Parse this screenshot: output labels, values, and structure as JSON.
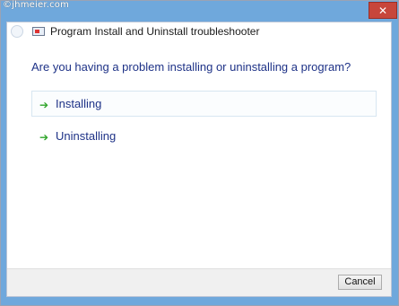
{
  "watermark": "©jhmeier.com",
  "window": {
    "title": "Program Install and Uninstall troubleshooter",
    "close_glyph": "✕"
  },
  "main": {
    "question": "Are you having a problem installing or uninstalling a program?",
    "options": [
      {
        "label": "Installing",
        "icon": "green-arrow-icon"
      },
      {
        "label": "Uninstalling",
        "icon": "green-arrow-icon"
      }
    ],
    "arrow_glyph": "➔"
  },
  "footer": {
    "cancel_label": "Cancel"
  },
  "colors": {
    "accent": "#1e3287",
    "arrow": "#2fa52a",
    "frame": "#6fa8dc",
    "close": "#c7463b"
  }
}
